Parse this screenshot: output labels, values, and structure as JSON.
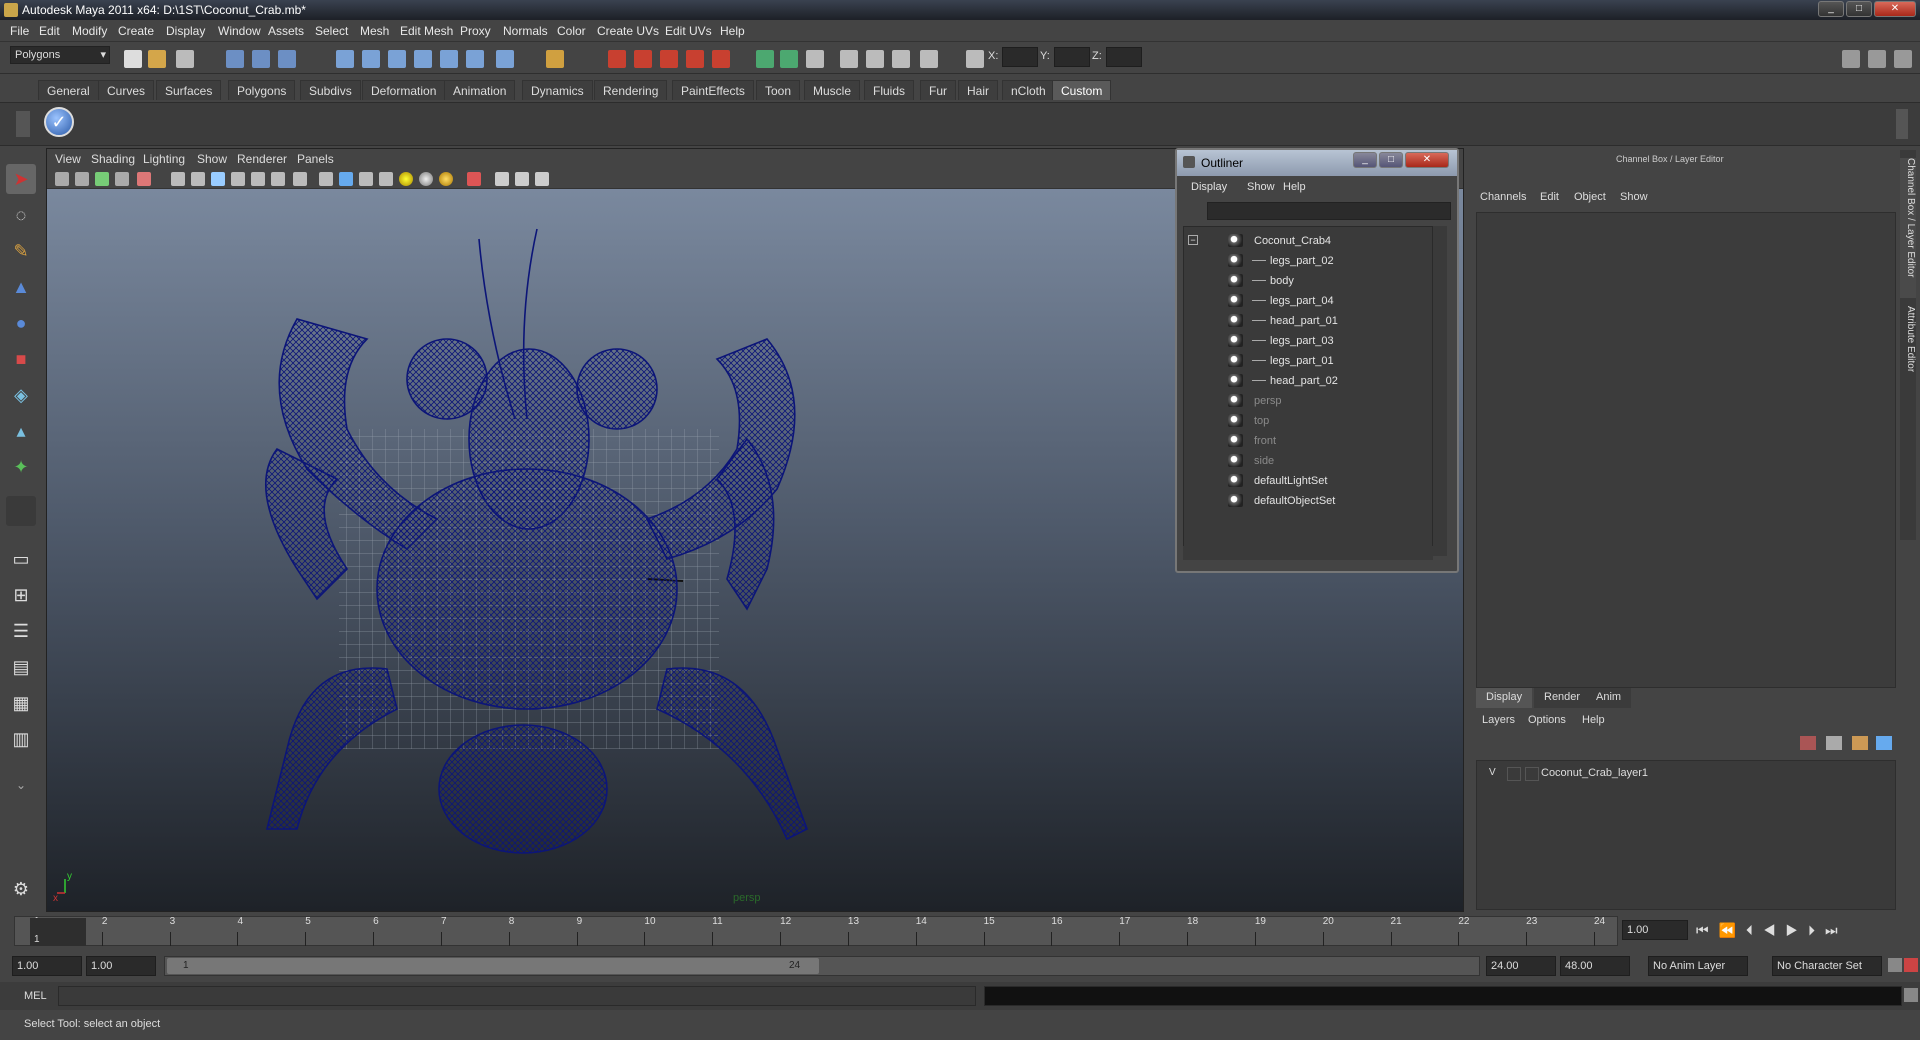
{
  "window": {
    "title": "Autodesk Maya 2011 x64: D:\\1ST\\Coconut_Crab.mb*",
    "controls": [
      "_",
      "□",
      "✕"
    ]
  },
  "menubar": [
    "File",
    "Edit",
    "Modify",
    "Create",
    "Display",
    "Window",
    "Assets",
    "Select",
    "Mesh",
    "Edit Mesh",
    "Proxy",
    "Normals",
    "Color",
    "Create UVs",
    "Edit UVs",
    "Help"
  ],
  "statusline": {
    "mode": "Polygons",
    "x_label": "X:",
    "y_label": "Y:",
    "z_label": "Z:"
  },
  "shelf_tabs": [
    "General",
    "Curves",
    "Surfaces",
    "Polygons",
    "Subdivs",
    "Deformation",
    "Animation",
    "Dynamics",
    "Rendering",
    "PaintEffects",
    "Toon",
    "Muscle",
    "Fluids",
    "Fur",
    "Hair",
    "nCloth",
    "Custom"
  ],
  "shelf_active": "Custom",
  "viewport": {
    "menu": [
      "View",
      "Shading",
      "Lighting",
      "Show",
      "Renderer",
      "Panels"
    ],
    "camera_label": "persp",
    "axis_x": "x",
    "axis_y": "y"
  },
  "outliner": {
    "title": "Outliner",
    "menu": [
      "Display",
      "Show",
      "Help"
    ],
    "items": [
      {
        "label": "Coconut_Crab4",
        "level": 0,
        "dim": false
      },
      {
        "label": "legs_part_02",
        "level": 1,
        "dim": false
      },
      {
        "label": "body",
        "level": 1,
        "dim": false
      },
      {
        "label": "legs_part_04",
        "level": 1,
        "dim": false
      },
      {
        "label": "head_part_01",
        "level": 1,
        "dim": false
      },
      {
        "label": "legs_part_03",
        "level": 1,
        "dim": false
      },
      {
        "label": "legs_part_01",
        "level": 1,
        "dim": false
      },
      {
        "label": "head_part_02",
        "level": 1,
        "dim": false
      },
      {
        "label": "persp",
        "level": 0,
        "dim": true
      },
      {
        "label": "top",
        "level": 0,
        "dim": true
      },
      {
        "label": "front",
        "level": 0,
        "dim": true
      },
      {
        "label": "side",
        "level": 0,
        "dim": true
      },
      {
        "label": "defaultLightSet",
        "level": 0,
        "dim": false
      },
      {
        "label": "defaultObjectSet",
        "level": 0,
        "dim": false
      }
    ]
  },
  "channelbox": {
    "title": "Channel Box / Layer Editor",
    "menu": [
      "Channels",
      "Edit",
      "Object",
      "Show"
    ],
    "side_tabs": [
      "Channel Box / Layer Editor",
      "Attribute Editor"
    ]
  },
  "layer_editor": {
    "tabs": [
      "Display",
      "Render",
      "Anim"
    ],
    "active_tab": "Display",
    "menu": [
      "Layers",
      "Options",
      "Help"
    ],
    "layers": [
      {
        "visible": "V",
        "name": "Coconut_Crab_layer1"
      }
    ]
  },
  "timeline": {
    "ticks": [
      "1",
      "2",
      "3",
      "4",
      "5",
      "6",
      "7",
      "8",
      "9",
      "10",
      "11",
      "12",
      "13",
      "14",
      "15",
      "16",
      "17",
      "18",
      "19",
      "20",
      "21",
      "22",
      "23",
      "24"
    ],
    "current_frame": "1",
    "current_time": "1.00"
  },
  "range": {
    "start": "1.00",
    "playback_start": "1.00",
    "slider_start": "1",
    "slider_end": "24",
    "playback_end": "24.00",
    "end": "48.00",
    "anim_layer": "No Anim Layer",
    "char_set": "No Character Set"
  },
  "cmdline": {
    "label": "MEL"
  },
  "helpline": {
    "text": "Select Tool: select an object"
  },
  "colors": {
    "wireframe": "#0c1578",
    "accent": "#5a87c5"
  }
}
